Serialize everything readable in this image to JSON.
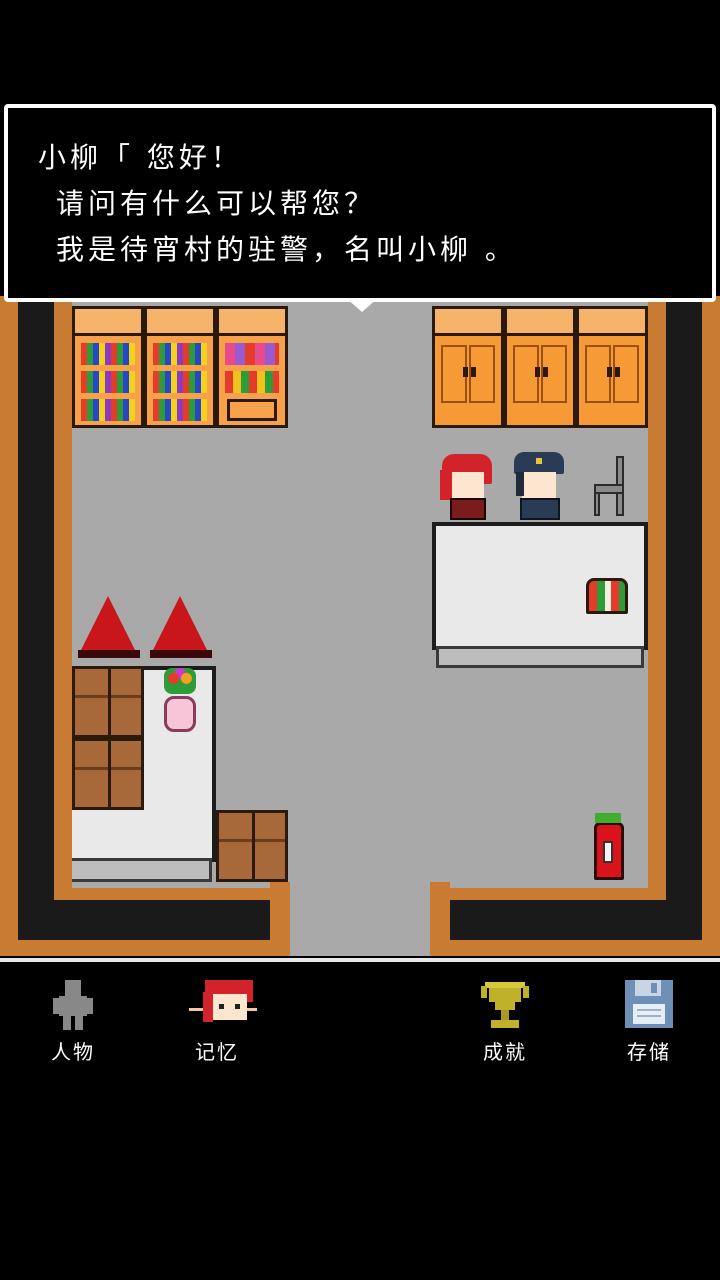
{
  "dialog": {
    "line1": "小柳「 您好！",
    "line2": "请问有什么可以帮您？",
    "line3": "我是待宵村的驻警，名叫小柳 。"
  },
  "menu": {
    "items": [
      {
        "label": "人物",
        "icon": "person-icon"
      },
      {
        "label": "记忆",
        "icon": "memory-portrait-icon"
      },
      {
        "label": "成就",
        "icon": "trophy-icon"
      },
      {
        "label": "存储",
        "icon": "save-floppy-icon"
      }
    ]
  },
  "colors": {
    "wall": "#c97a33",
    "floor": "#a9a9a9",
    "dialog_bg": "#000000",
    "dialog_border": "#ffffff",
    "trophy": "#bfb12a",
    "floppy": "#6e8fb6"
  }
}
